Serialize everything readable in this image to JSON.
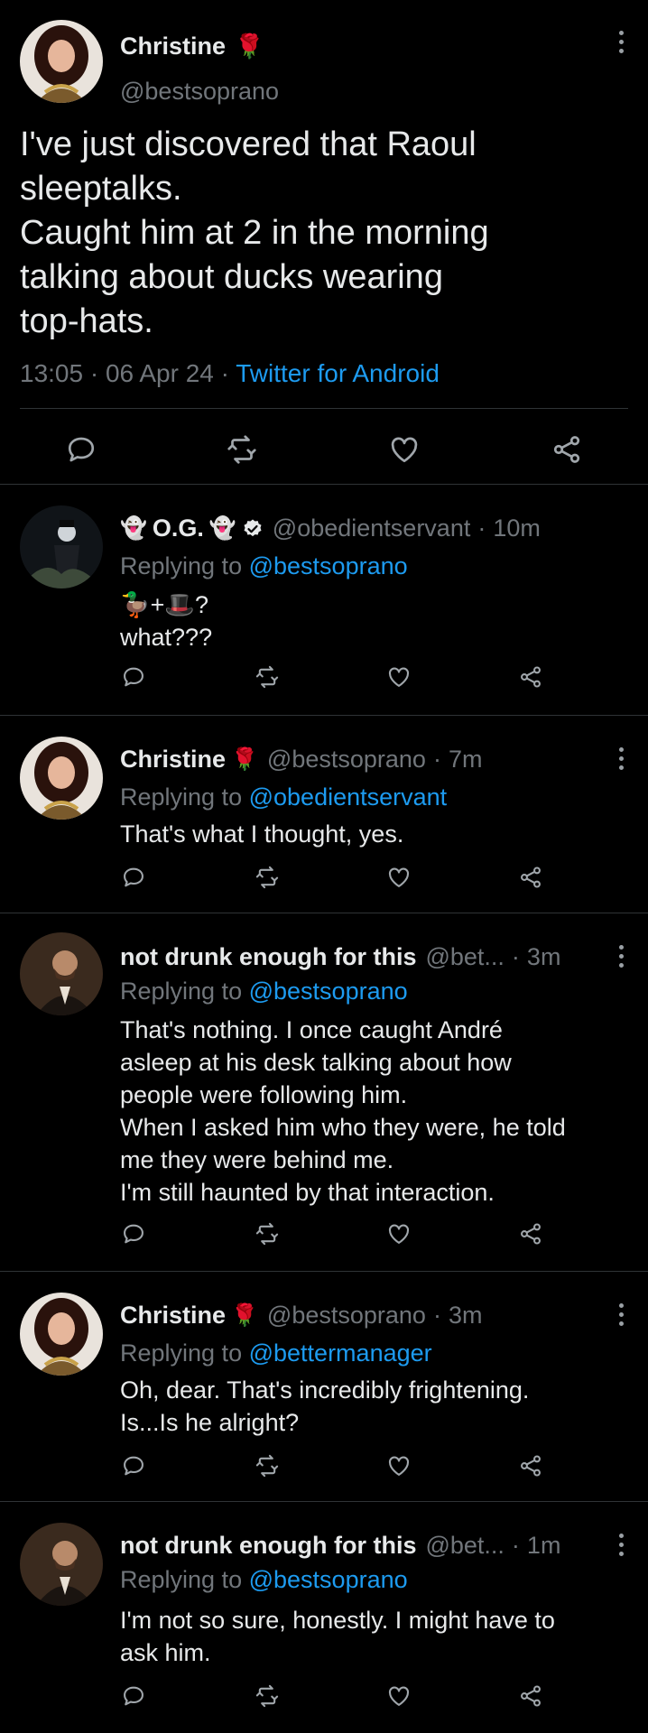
{
  "main_tweet": {
    "name": "Christine",
    "name_emoji": "🌹",
    "handle": "@bestsoprano",
    "text_lines": [
      "I've just discovered that Raoul",
      "sleeptalks.",
      "Caught him at 2 in the morning",
      "talking about ducks wearing",
      "top-hats."
    ],
    "time": "13:05",
    "date": "06 Apr 24",
    "client": "Twitter for Android",
    "sep": "·"
  },
  "replies": [
    {
      "name": "O.G.",
      "emoji_left": "👻",
      "emoji_right": "👻",
      "verified": true,
      "handle": "@obedientservant",
      "age": "10m",
      "replying_label": "Replying to",
      "replying_to": "@bestsoprano",
      "lines": [
        "🦆+🎩?",
        "what???"
      ],
      "has_more": false
    },
    {
      "name": "Christine",
      "emoji_right": "🌹",
      "handle": "@bestsoprano",
      "age": "7m",
      "replying_label": "Replying to",
      "replying_to": "@obedientservant",
      "lines": [
        "That's what I thought, yes."
      ],
      "has_more": true
    },
    {
      "name": "not drunk enough for this",
      "handle": "@bet...",
      "age": "3m",
      "replying_label": "Replying to",
      "replying_to": "@bestsoprano",
      "lines": [
        "That's nothing. I once caught André",
        "asleep at his desk talking about how",
        "people were following him.",
        "When I asked him who they were, he told",
        "me they were behind me.",
        "I'm still haunted by that interaction."
      ],
      "has_more": true
    },
    {
      "name": "Christine",
      "emoji_right": "🌹",
      "handle": "@bestsoprano",
      "age": "3m",
      "replying_label": "Replying to",
      "replying_to": "@bettermanager",
      "lines": [
        "Oh, dear. That's incredibly frightening.",
        "Is...Is he alright?"
      ],
      "has_more": true
    },
    {
      "name": "not drunk enough for this",
      "handle": "@bet...",
      "age": "1m",
      "replying_label": "Replying to",
      "replying_to": "@bestsoprano",
      "lines": [
        "I'm not so sure, honestly. I might have to",
        "ask him."
      ],
      "has_more": true
    }
  ],
  "icons": {
    "reply": "speech-bubble",
    "retweet": "retweet-arrows",
    "like": "heart",
    "share": "share-nodes",
    "more": "vertical-dots"
  },
  "colors": {
    "background": "#000000",
    "text": "#e7e9ea",
    "muted": "#71767b",
    "link": "#1d9bf0",
    "divider": "#2f3336",
    "verified": "#e7e9ea"
  }
}
